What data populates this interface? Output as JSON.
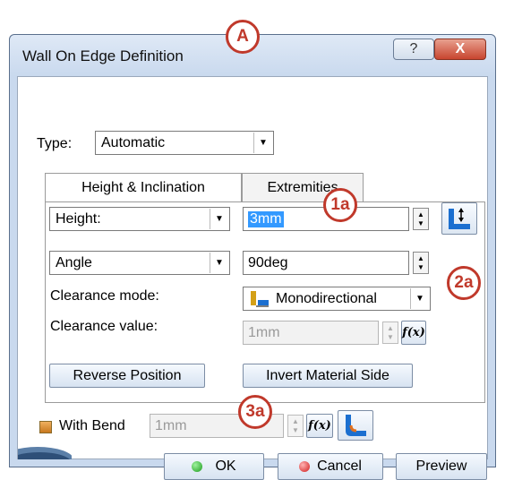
{
  "window": {
    "title": "Wall On Edge Definition",
    "help_glyph": "?",
    "close_glyph": "X"
  },
  "type": {
    "label": "Type:",
    "value": "Automatic"
  },
  "tabs": [
    {
      "label": "Height & Inclination",
      "active": true
    },
    {
      "label": "Extremities",
      "active": false
    }
  ],
  "height": {
    "mode": "Height:",
    "value": "3mm"
  },
  "angle": {
    "mode": "Angle",
    "value": "90deg"
  },
  "clearance": {
    "mode_label": "Clearance mode:",
    "mode_value": "Monodirectional",
    "value_label": "Clearance value:",
    "value": "1mm"
  },
  "buttons": {
    "reverse_position": "Reverse Position",
    "invert_material_side": "Invert Material Side",
    "ok": "OK",
    "cancel": "Cancel",
    "preview": "Preview"
  },
  "with_bend": {
    "label": "With Bend",
    "value": "1mm",
    "checked": true
  },
  "formula_glyph": "f(x)",
  "callouts": {
    "A": "A",
    "1a": "1a",
    "2a": "2a",
    "3a": "3a"
  },
  "colors": {
    "callout": "#c0392b",
    "window_frame": "#c9d9ee",
    "selection": "#3399ff"
  }
}
